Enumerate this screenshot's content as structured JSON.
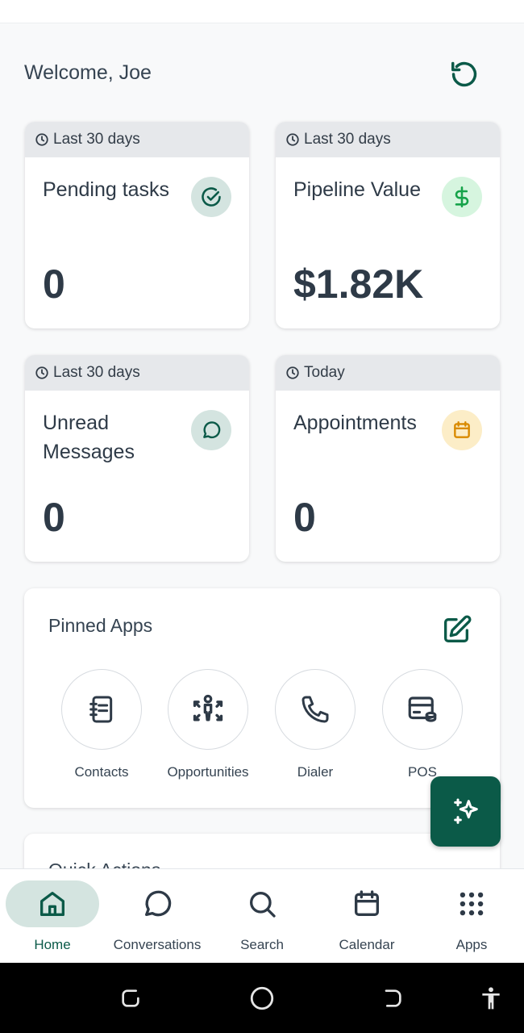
{
  "header": {
    "welcome": "Welcome, Joe",
    "refresh_icon": "refresh-icon"
  },
  "cards": [
    {
      "period": "Last 30 days",
      "title": "Pending tasks",
      "value": "0",
      "icon": "check-circle-icon",
      "icon_bg": "#d4e4e0",
      "icon_color": "#0b5a48"
    },
    {
      "period": "Last 30 days",
      "title": "Pipeline Value",
      "value": "$1.82K",
      "icon": "dollar-icon",
      "icon_bg": "#d6f5df",
      "icon_color": "#16a34a"
    },
    {
      "period": "Last 30 days",
      "title": "Unread Messages",
      "value": "0",
      "icon": "message-icon",
      "icon_bg": "#d4e4e0",
      "icon_color": "#0b5a48"
    },
    {
      "period": "Today",
      "title": "Appointments",
      "value": "0",
      "icon": "calendar-icon",
      "icon_bg": "#fcedc7",
      "icon_color": "#d98a00"
    }
  ],
  "pinned": {
    "title": "Pinned Apps",
    "apps": [
      {
        "label": "Contacts",
        "icon": "contacts-book-icon"
      },
      {
        "label": "Opportunities",
        "icon": "opportunities-icon"
      },
      {
        "label": "Dialer",
        "icon": "phone-icon"
      },
      {
        "label": "POS",
        "icon": "pos-icon"
      }
    ]
  },
  "quick_actions": {
    "title": "Quick Actions"
  },
  "nav": [
    {
      "label": "Home",
      "icon": "home-icon",
      "active": true
    },
    {
      "label": "Conversations",
      "icon": "conversations-icon"
    },
    {
      "label": "Search",
      "icon": "search-icon"
    },
    {
      "label": "Calendar",
      "icon": "calendar-icon"
    },
    {
      "label": "Apps",
      "icon": "apps-grid-icon"
    }
  ],
  "colors": {
    "primary": "#0b5a48",
    "text": "#2e3a47",
    "card_header": "#e6e8eb"
  }
}
